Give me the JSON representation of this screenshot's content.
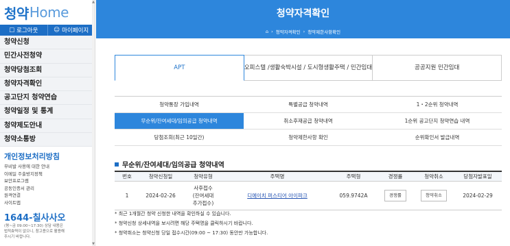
{
  "sidebar": {
    "logo_prefix": "청약",
    "logo_suffix": "Home",
    "logout": "로그아웃",
    "mypage": "마이페이지",
    "nav": [
      "청약신청",
      "민간사전청약",
      "청약당첨조회",
      "청약자격확인",
      "공고단지 청약연습",
      "청약일정 및 통계",
      "청약제도안내",
      "청약소통방"
    ],
    "privacy_title": "개인정보처리방침",
    "sub_links": [
      "무비발 사용에 대한 안내",
      "이메일 주출방지정책",
      "보안프로그램",
      "공동인증서 관리",
      "원격연결",
      "사이트맵"
    ],
    "phone": "1644-칠사사오",
    "phone_note_1": "(평~금 09:00~17:30) 상담 내용은",
    "phone_note_2": "법적효력이 없으니, 참고용으로 활용해",
    "phone_note_3": "주시기 바랍니다."
  },
  "banner": {
    "title": "청약자격확인",
    "crumb_1": "청약자격확인",
    "crumb_2": "청약제한사항확인"
  },
  "top_tabs": [
    "APT",
    "오피스텔 /생활숙박시설 / 도시형생활주택 / 민간임대",
    "공공지원 민간임대"
  ],
  "sub_tabs": [
    [
      "청약통장 가입내역",
      "특별공급 청약내역",
      "1・2순위 청약내역"
    ],
    [
      "무순위/잔여세대/임의공급 청약내역",
      "취소후재공급 청약내역",
      "1순위 공고단지 청약연습 내역"
    ],
    [
      "당첨조회(최근 10일간)",
      "청약제한사항 확인",
      "순위확인서 발급내역"
    ]
  ],
  "section_title": "무순위/잔여세대/임의공급 청약내역",
  "table": {
    "headers": [
      "번호",
      "청약신청일",
      "청약유형",
      "주택명",
      "주택형",
      "경쟁률",
      "청약취소",
      "당첨자발표일"
    ],
    "row": {
      "no": "1",
      "date": "2024-02-26",
      "type_1": "사후접수",
      "type_2": "(잔여세대",
      "type_3": "추가접수)",
      "house": "디에이치 퍼스티어 아이파크",
      "size": "059.9742A",
      "rate_btn": "경쟁률",
      "cancel_btn": "청약취소",
      "announce": "2024-02-29"
    }
  },
  "notes": [
    "* 최근 1개월간 청약 신청한 내역을 확인하실 수 있습니다.",
    "* 청약신청 상세내역을 보시려면 해당 주택명을 클릭하시기 바랍니다.",
    "* 청약취소는 청약신청 당일 접수시간(09:00 ~ 17:30) 동안만 가능합니다."
  ],
  "colors": {
    "primary": "#2d86dc",
    "dark_blue": "#1d6ec5"
  }
}
